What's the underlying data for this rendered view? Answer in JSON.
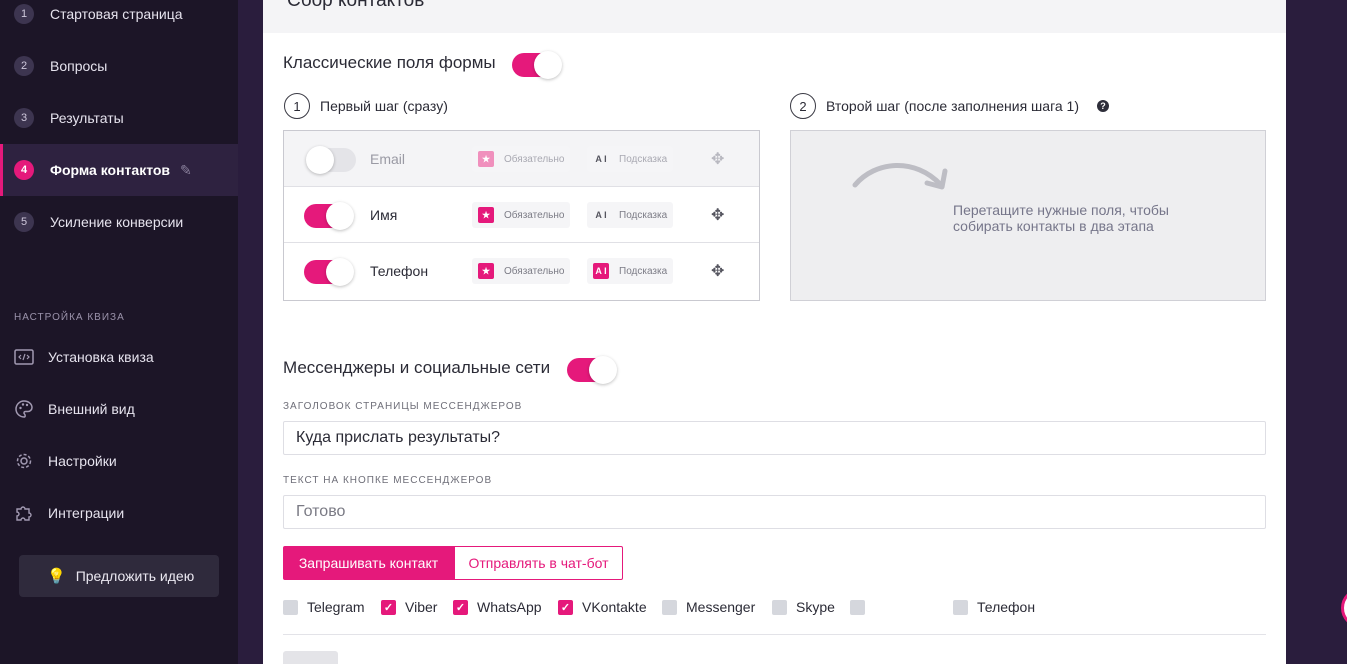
{
  "sidebar": {
    "steps": [
      {
        "num": "1",
        "label": "Стартовая страница"
      },
      {
        "num": "2",
        "label": "Вопросы"
      },
      {
        "num": "3",
        "label": "Результаты"
      },
      {
        "num": "4",
        "label": "Форма контактов"
      },
      {
        "num": "5",
        "label": "Усиление конверсии"
      }
    ],
    "section_label": "НАСТРОЙКА КВИЗА",
    "menu": [
      {
        "label": "Установка квиза",
        "icon": "code-icon"
      },
      {
        "label": "Внешний вид",
        "icon": "palette-icon"
      },
      {
        "label": "Настройки",
        "icon": "gear-icon"
      },
      {
        "label": "Интеграции",
        "icon": "puzzle-icon"
      }
    ],
    "idea_label": "Предложить идею"
  },
  "panel": {
    "title": "Сбор контактов",
    "classic": {
      "title": "Классические поля формы",
      "enabled": true,
      "step1": {
        "num": "1",
        "label": "Первый шаг (сразу)"
      },
      "step2": {
        "num": "2",
        "label": "Второй шаг (после заполнения шага 1)",
        "help": "?"
      },
      "required_label": "Обязательно",
      "hint_label": "Подсказка",
      "fields": [
        {
          "name": "Email",
          "enabled": false
        },
        {
          "name": "Имя",
          "enabled": true
        },
        {
          "name": "Телефон",
          "enabled": true
        }
      ],
      "dropzone_text": "Перетащите нужные поля, чтобы собирать контакты в два этапа"
    },
    "messengers": {
      "title": "Мессенджеры и социальные сети",
      "enabled": true,
      "header_label": "ЗАГОЛОВОК СТРАНИЦЫ МЕССЕНДЖЕРОВ",
      "header_value": "Куда прислать результаты?",
      "button_label": "ТЕКСТ НА КНОПКЕ МЕССЕНДЖЕРОВ",
      "button_placeholder": "Готово",
      "mode_request": "Запрашивать контакт",
      "mode_chatbot": "Отправлять в чат-бот",
      "options": [
        {
          "label": "Telegram",
          "checked": false
        },
        {
          "label": "Viber",
          "checked": true
        },
        {
          "label": "WhatsApp",
          "checked": true
        },
        {
          "label": "VKontakte",
          "checked": true
        },
        {
          "label": "Messenger",
          "checked": false
        },
        {
          "label": "Skype",
          "checked": false
        },
        {
          "label": "",
          "checked": false
        },
        {
          "label": "Телефон",
          "checked": false
        }
      ]
    }
  },
  "colors": {
    "accent": "#e5197b",
    "sidebar_bg": "#1c1527",
    "page_bg": "#2a1d3d"
  }
}
